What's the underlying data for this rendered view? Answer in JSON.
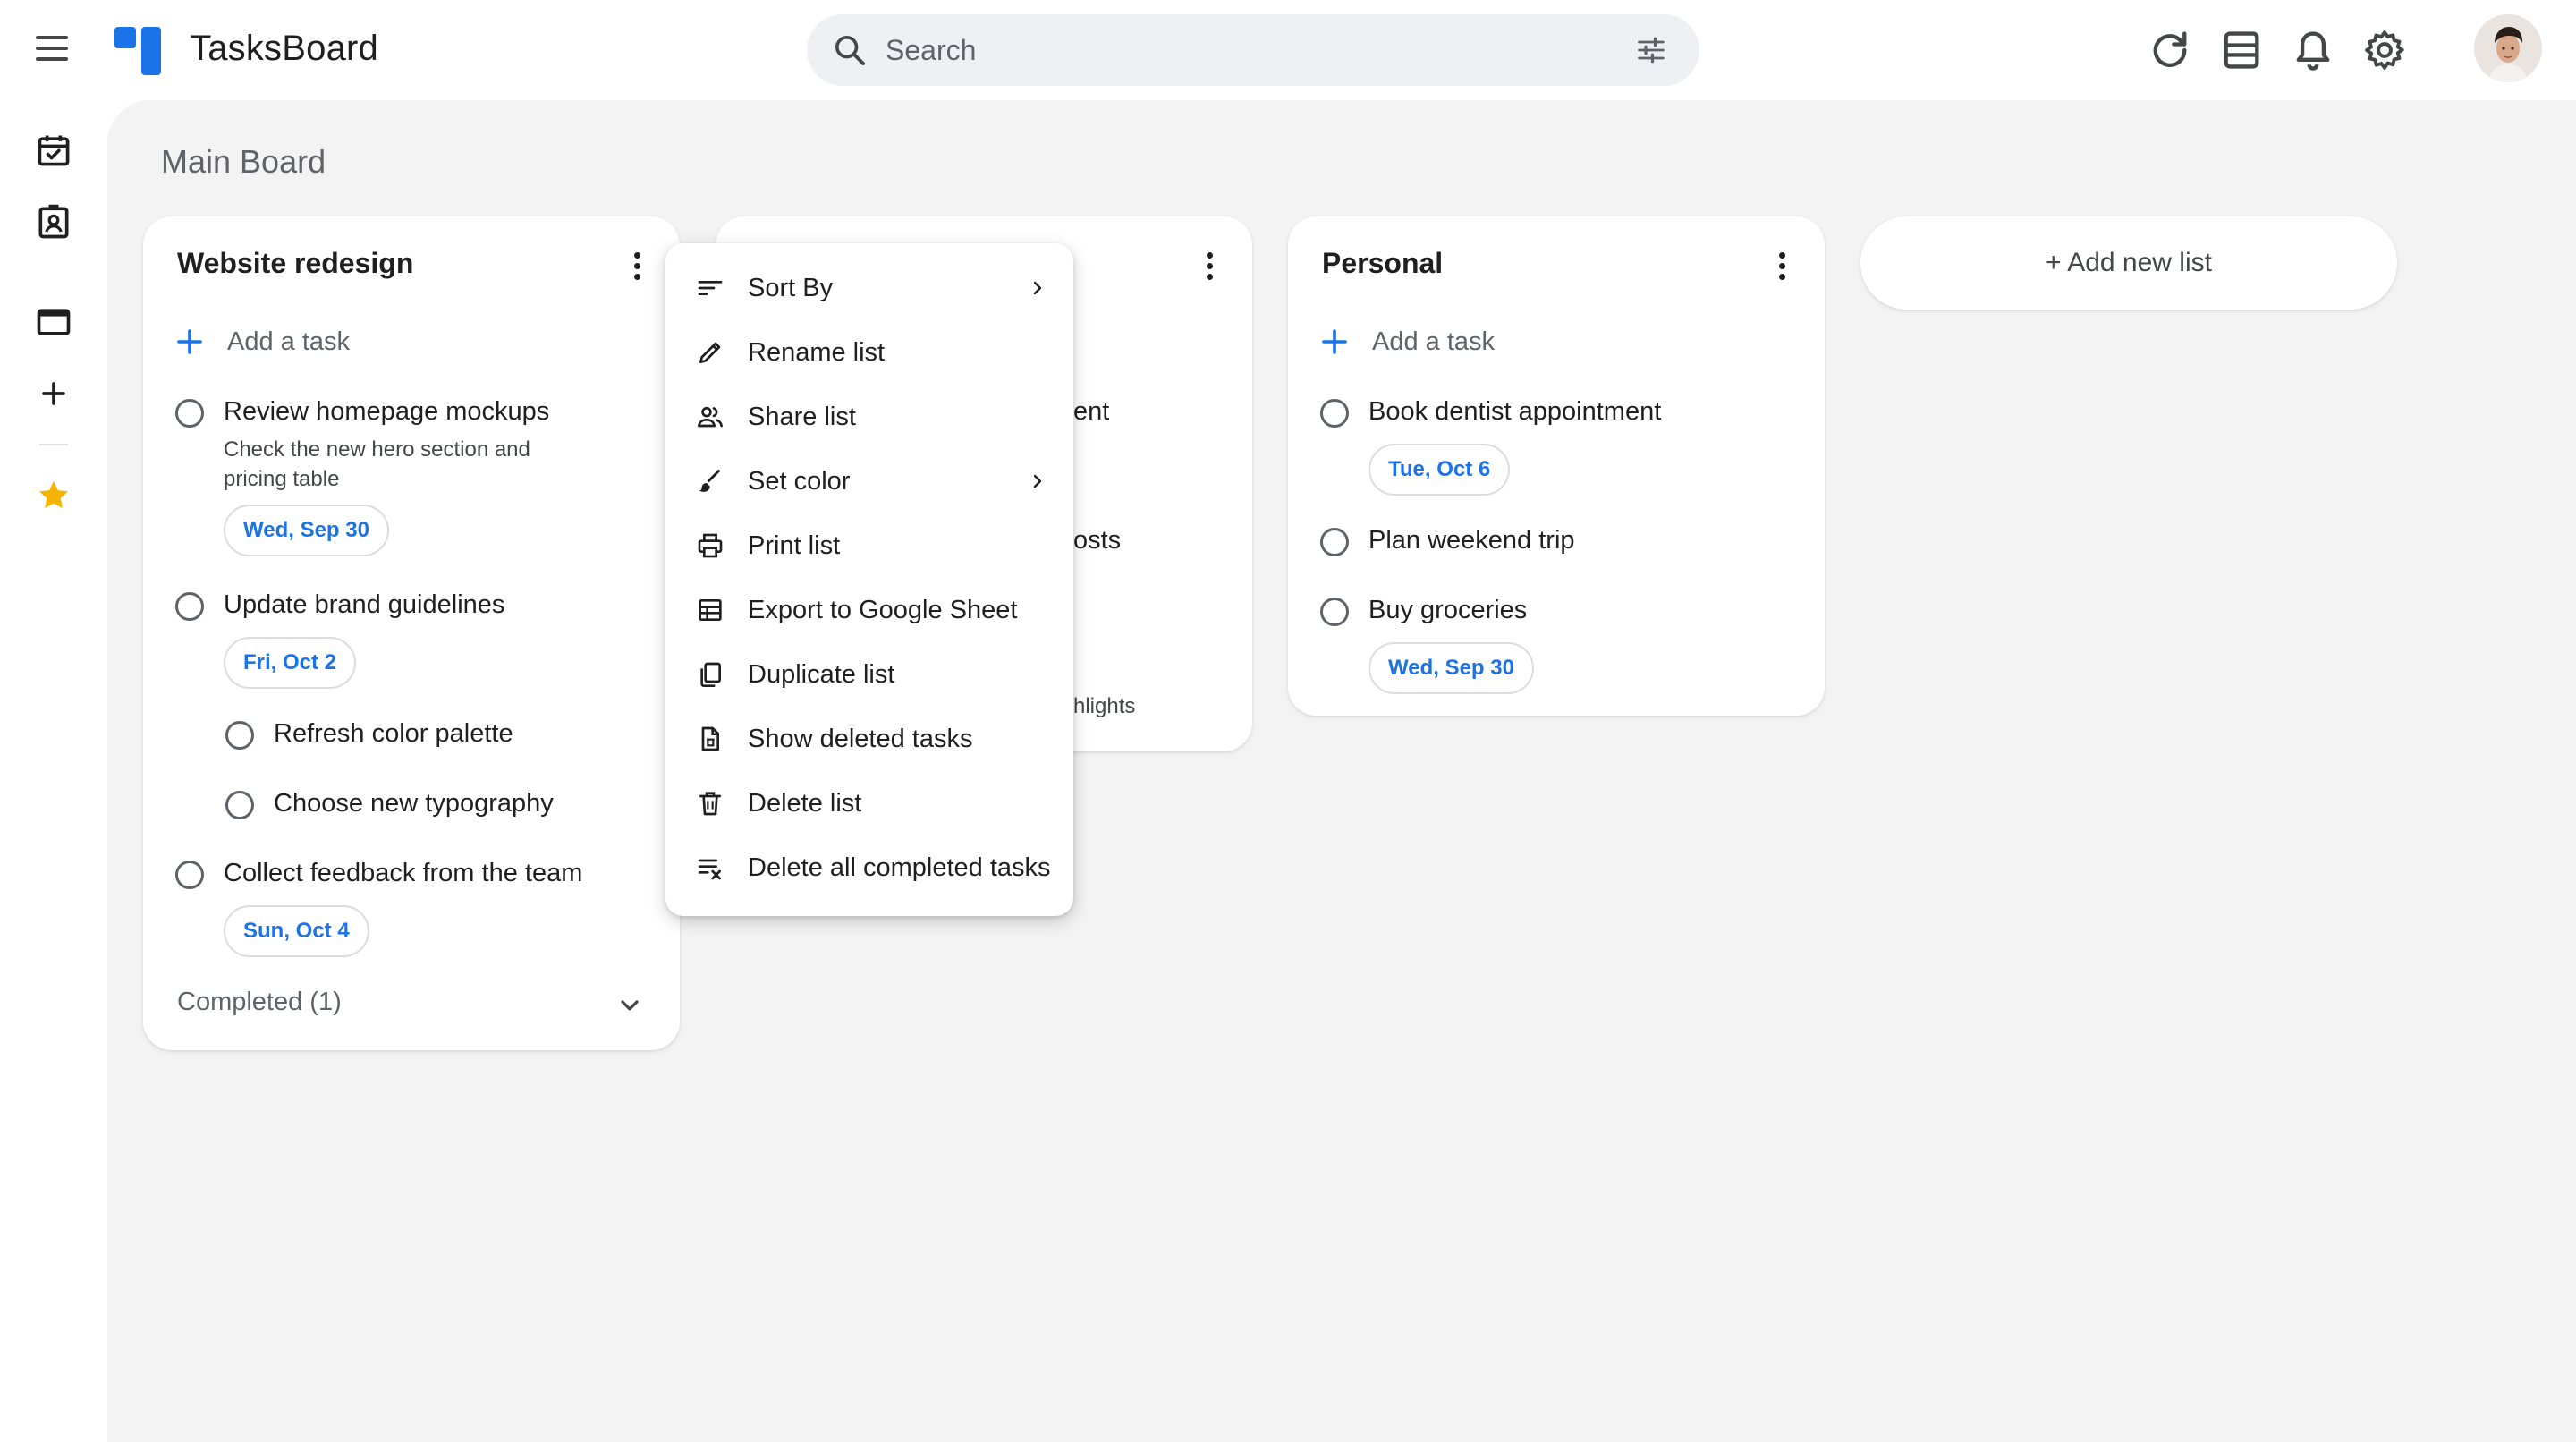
{
  "app": {
    "title": "TasksBoard"
  },
  "search": {
    "placeholder": "Search",
    "value": ""
  },
  "header": {
    "icons": [
      "refresh-icon",
      "view-icon",
      "notifications-icon",
      "settings-icon"
    ]
  },
  "rail": {
    "icons": [
      "calendar-check-icon",
      "contacts-icon",
      "window-icon",
      "add-icon",
      "star-icon"
    ]
  },
  "board": {
    "title": "Main Board"
  },
  "lists": [
    {
      "title": "Website redesign",
      "add_task": "Add a task",
      "tasks": [
        {
          "title": "Review homepage mockups",
          "notes": "Check the new hero section and pricing table",
          "date": "Wed, Sep 30"
        },
        {
          "title": "Update brand guidelines",
          "date": "Fri, Oct 2"
        },
        {
          "title": "Refresh color palette"
        },
        {
          "title": "Choose new typography"
        },
        {
          "title": "Collect feedback from the team",
          "date": "Sun, Oct 4"
        }
      ],
      "completed": "Completed (1)"
    },
    {
      "fragments": [
        "ent",
        "osts",
        "hlights"
      ]
    },
    {
      "title": "Personal",
      "add_task": "Add a task",
      "tasks": [
        {
          "title": "Book dentist appointment",
          "date": "Tue, Oct 6"
        },
        {
          "title": "Plan weekend trip"
        },
        {
          "title": "Buy groceries",
          "date": "Wed, Sep 30"
        }
      ]
    }
  ],
  "add_list": {
    "label": "+ Add new list"
  },
  "context_menu": {
    "items": [
      {
        "label": "Sort By",
        "icon": "sort-icon",
        "submenu": true
      },
      {
        "label": "Rename list",
        "icon": "pencil-icon"
      },
      {
        "label": "Share list",
        "icon": "people-icon"
      },
      {
        "label": "Set color",
        "icon": "brush-icon",
        "submenu": true
      },
      {
        "label": "Print list",
        "icon": "print-icon"
      },
      {
        "label": "Export to Google Sheet",
        "icon": "table-icon"
      },
      {
        "label": "Duplicate list",
        "icon": "copy-icon"
      },
      {
        "label": "Show deleted tasks",
        "icon": "deleted-doc-icon"
      },
      {
        "label": "Delete list",
        "icon": "trash-icon"
      },
      {
        "label": "Delete all completed tasks",
        "icon": "clear-completed-icon"
      }
    ]
  },
  "colors": {
    "accent": "#1a73e8",
    "board_bg": "#f3f3f3",
    "star": "#f6b400",
    "text": "#1f1f1f",
    "muted": "#5f6368"
  }
}
